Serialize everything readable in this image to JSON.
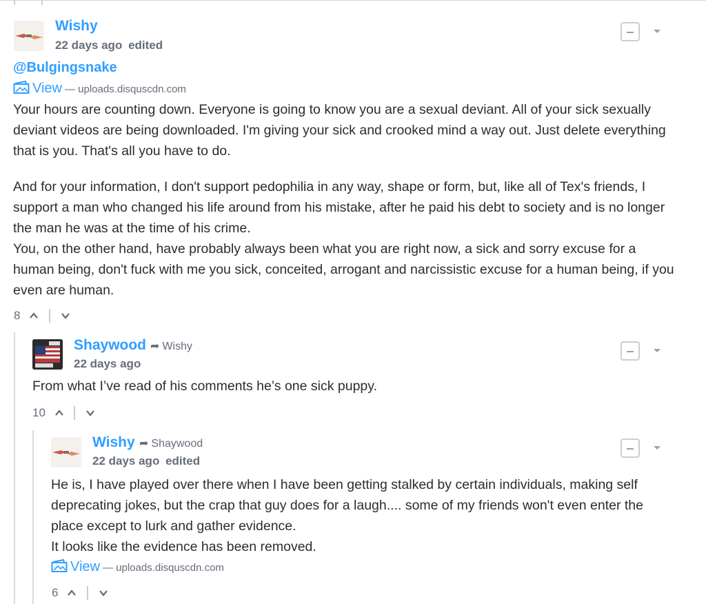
{
  "comments": [
    {
      "author": "Wishy",
      "reply_to": "",
      "timestamp": "22 days ago",
      "edited": "edited",
      "mention": "@Bulgingsnake",
      "attachment": {
        "link_label": "View",
        "source": "— uploads.disquscdn.com"
      },
      "paragraphs": [
        "Your hours are counting down. Everyone is going to know you are a sexual deviant. All of your sick sexually deviant videos are being downloaded. I'm giving your sick and crooked mind a way out. Just delete everything that is you. That's all you have to do.",
        "And for your information, I don't support pedophilia in any way, shape or form, but, like all of Tex's friends, I support a man who changed his life around from his mistake, after he paid his debt to society and is no longer the man he was at the time of his crime.",
        "You, on the other hand, have probably always been what you are right now, a sick and sorry excuse for a human being, don't fuck with me you sick, conceited, arrogant and narcissistic excuse for a human being, if you even are human."
      ],
      "upvotes": "8"
    },
    {
      "author": "Shaywood",
      "reply_to": "Wishy",
      "timestamp": "22 days ago",
      "edited": "",
      "paragraphs": [
        "From what I’ve read of his comments he’s one sick puppy."
      ],
      "upvotes": "10"
    },
    {
      "author": "Wishy",
      "reply_to": "Shaywood",
      "timestamp": "22 days ago",
      "edited": "edited",
      "paragraphs": [
        "He is, I have played over there when I have been getting stalked by certain individuals, making self deprecating jokes, but the crap that guy does for a laugh.... some of my friends won't even enter the place except to lurk and gather evidence.",
        "It looks like the evidence has been removed."
      ],
      "attachment": {
        "link_label": "View",
        "source": "— uploads.disquscdn.com"
      },
      "upvotes": "6"
    }
  ],
  "colors": {
    "link": "#2e9fff",
    "meta": "#656c7a",
    "text": "#2a2e2e",
    "thread_line": "#d7dadd"
  },
  "icons": {
    "collapse": "collapse-box-icon",
    "menu": "caret-down-icon",
    "upvote": "chevron-up-icon",
    "downvote": "chevron-down-icon",
    "reply": "reply-arrow-icon",
    "image": "image-icon"
  }
}
